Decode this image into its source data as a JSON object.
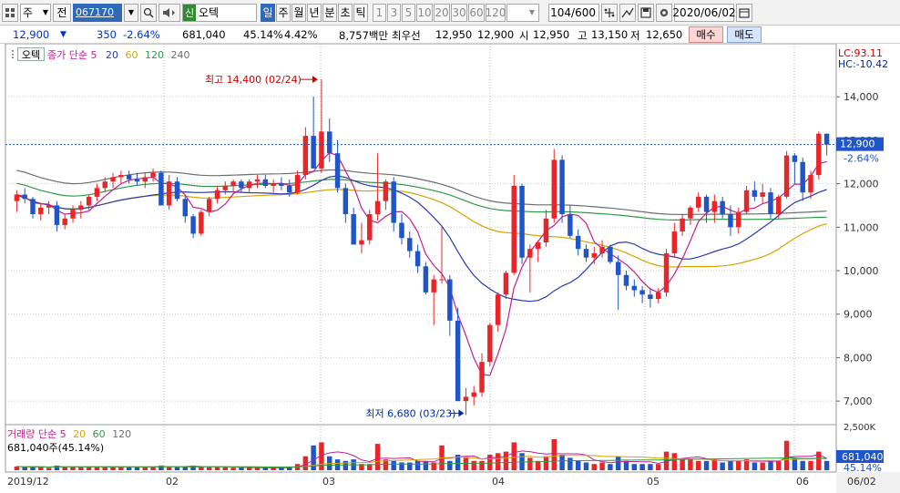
{
  "toolbar": {
    "market": "주",
    "prefix": "전",
    "code": "067170",
    "stock_name": "오텍",
    "tag": "신",
    "periods": [
      "일",
      "주",
      "월",
      "년",
      "분",
      "초",
      "틱"
    ],
    "periods_active": 0,
    "intervals": [
      "1",
      "3",
      "5",
      "10",
      "20",
      "30",
      "60",
      "120"
    ],
    "page_count": "104/600",
    "date": "2020/06/02"
  },
  "quote": {
    "price": "12,900",
    "change": "350",
    "change_pct": "-2.64%",
    "volume": "681,040",
    "volume_ratio": "45.14%",
    "turnover": "4.42%",
    "amount": "8,757백만",
    "best_label": "최우선",
    "best_ask": "12,950",
    "best_bid": "12,900",
    "open_label": "시",
    "open": "12,950",
    "high_label": "고",
    "high": "13,150",
    "low_label": "저",
    "low": "12,650",
    "buy_label": "매수",
    "sell_label": "매도"
  },
  "chart_data": {
    "type": "candlestick",
    "price_legend": {
      "tab": "오텍",
      "ma_label": "종가 단순",
      "periods": [
        "5",
        "20",
        "60",
        "120",
        "240"
      ]
    },
    "volume_legend": {
      "title": "거래량 단순",
      "periods": [
        "5",
        "20",
        "60",
        "120"
      ],
      "value": "681,040주(45.14%)"
    },
    "annotations": {
      "high": "최고 14,400 (02/24)",
      "low": "최저 6,680 (03/23)",
      "lc": "LC:93.11",
      "hc": "HC:-10.42"
    },
    "last_price": {
      "value": "12,900",
      "change": "-2.64%"
    },
    "last_volume": {
      "value": "681,040",
      "pct": "45.14%"
    },
    "price_ticks": [
      "14,000",
      "13,000",
      "12,000",
      "11,000",
      "10,000",
      "9,000",
      "8,000",
      "7,000"
    ],
    "price_tick_values": [
      14000,
      13000,
      12000,
      11000,
      10000,
      9000,
      8000,
      7000
    ],
    "volume_tick": "2,500K",
    "x_labels": [
      "2019/12",
      "02",
      "03",
      "04",
      "05",
      "06",
      "06/02"
    ],
    "ylim": [
      6500,
      14800
    ],
    "colors": {
      "up": "#e8262a",
      "down": "#1f55c8",
      "ma5": "#c02090",
      "ma20": "#2a3bb0",
      "ma60": "#d6a300",
      "ma120": "#2e9a48",
      "ma240": "#6e6e6e"
    },
    "candles": [
      [
        11600,
        11850,
        11350,
        11750
      ],
      [
        11750,
        11900,
        11550,
        11650
      ],
      [
        11650,
        11700,
        11200,
        11300
      ],
      [
        11300,
        11550,
        11150,
        11450
      ],
      [
        11450,
        11600,
        11300,
        11500
      ],
      [
        11500,
        11600,
        10900,
        11050
      ],
      [
        11050,
        11300,
        10950,
        11200
      ],
      [
        11200,
        11500,
        11100,
        11400
      ],
      [
        11400,
        11600,
        11200,
        11500
      ],
      [
        11500,
        11750,
        11400,
        11700
      ],
      [
        11700,
        12000,
        11600,
        11900
      ],
      [
        11900,
        12150,
        11800,
        12050
      ],
      [
        12050,
        12250,
        11900,
        12150
      ],
      [
        12150,
        12300,
        12000,
        12200
      ],
      [
        12200,
        12300,
        12000,
        12100
      ],
      [
        12100,
        12250,
        11950,
        12050
      ],
      [
        12050,
        12250,
        11900,
        12150
      ],
      [
        12150,
        12350,
        12050,
        12250
      ],
      [
        12250,
        12300,
        11750,
        11500
      ],
      [
        11500,
        12200,
        11400,
        12050
      ],
      [
        12050,
        12150,
        11600,
        11650
      ],
      [
        11650,
        11700,
        11100,
        11250
      ],
      [
        11250,
        11300,
        10750,
        10850
      ],
      [
        10850,
        11400,
        10800,
        11350
      ],
      [
        11350,
        11700,
        11250,
        11650
      ],
      [
        11650,
        11950,
        11550,
        11850
      ],
      [
        11850,
        12050,
        11750,
        11950
      ],
      [
        11950,
        12100,
        11800,
        12050
      ],
      [
        12050,
        12100,
        11800,
        11900
      ],
      [
        11900,
        12100,
        11800,
        12050
      ],
      [
        12050,
        12200,
        11900,
        12100
      ],
      [
        12100,
        12200,
        11900,
        11950
      ],
      [
        11950,
        12100,
        11800,
        12000
      ],
      [
        12000,
        12150,
        11850,
        11950
      ],
      [
        11950,
        12100,
        11700,
        11800
      ],
      [
        11800,
        12300,
        11750,
        12200
      ],
      [
        12200,
        13300,
        12100,
        13100
      ],
      [
        13100,
        14000,
        12600,
        12350
      ],
      [
        12350,
        14400,
        12250,
        13200
      ],
      [
        13200,
        13500,
        12500,
        12700
      ],
      [
        12700,
        13000,
        11800,
        11900
      ],
      [
        11900,
        12000,
        11100,
        11300
      ],
      [
        11300,
        11450,
        10600,
        10600
      ],
      [
        10600,
        11100,
        10400,
        10700
      ],
      [
        10700,
        11400,
        10600,
        11300
      ],
      [
        11300,
        12700,
        11150,
        11600
      ],
      [
        11600,
        12100,
        11400,
        12050
      ],
      [
        12050,
        12150,
        10900,
        11100
      ],
      [
        11100,
        11300,
        10600,
        10750
      ],
      [
        10750,
        10900,
        10300,
        10450
      ],
      [
        10450,
        10600,
        9950,
        10100
      ],
      [
        10100,
        10200,
        9450,
        9500
      ],
      [
        9500,
        9900,
        8750,
        9800
      ],
      [
        9800,
        11000,
        9700,
        9800
      ],
      [
        9800,
        9900,
        8500,
        8850
      ],
      [
        8850,
        9150,
        7000,
        7000
      ],
      [
        7000,
        7300,
        6680,
        7100
      ],
      [
        7100,
        7350,
        6900,
        7200
      ],
      [
        7200,
        8100,
        7100,
        7900
      ],
      [
        7900,
        8800,
        7800,
        8750
      ],
      [
        8750,
        9500,
        8600,
        9450
      ],
      [
        9450,
        10000,
        9350,
        9950
      ],
      [
        9950,
        12200,
        9900,
        11950
      ],
      [
        11950,
        12000,
        10150,
        10300
      ],
      [
        10300,
        10600,
        9500,
        10500
      ],
      [
        10500,
        10700,
        10200,
        10650
      ],
      [
        10650,
        11400,
        10550,
        11200
      ],
      [
        11200,
        12800,
        11100,
        12550
      ],
      [
        12550,
        12650,
        11100,
        11300
      ],
      [
        11300,
        11500,
        10750,
        10800
      ],
      [
        10800,
        10950,
        10350,
        10500
      ],
      [
        10500,
        10600,
        10200,
        10300
      ],
      [
        10300,
        10550,
        10150,
        10400
      ],
      [
        10400,
        10700,
        10300,
        10550
      ],
      [
        10550,
        10600,
        10150,
        10200
      ],
      [
        10200,
        10350,
        9100,
        9900
      ],
      [
        9900,
        10000,
        9550,
        9650
      ],
      [
        9650,
        9800,
        9400,
        9550
      ],
      [
        9550,
        9650,
        9250,
        9450
      ],
      [
        9450,
        9600,
        9150,
        9350
      ],
      [
        9350,
        9600,
        9250,
        9500
      ],
      [
        9500,
        10500,
        9400,
        10400
      ],
      [
        10400,
        11100,
        10300,
        10900
      ],
      [
        10900,
        11300,
        10800,
        11200
      ],
      [
        11200,
        11500,
        11050,
        11450
      ],
      [
        11450,
        11800,
        11350,
        11700
      ],
      [
        11700,
        11750,
        11100,
        11350
      ],
      [
        11350,
        11750,
        11100,
        11600
      ],
      [
        11600,
        11700,
        11200,
        11300
      ],
      [
        11300,
        11500,
        10800,
        11000
      ],
      [
        11000,
        11450,
        10850,
        11350
      ],
      [
        11350,
        11950,
        11300,
        11850
      ],
      [
        11850,
        12050,
        11600,
        11700
      ],
      [
        11700,
        12000,
        11550,
        11800
      ],
      [
        11800,
        11900,
        11200,
        11300
      ],
      [
        11300,
        11750,
        11200,
        11700
      ],
      [
        11700,
        12750,
        11650,
        12650
      ],
      [
        12650,
        12700,
        12000,
        12500
      ],
      [
        12500,
        12600,
        11600,
        11800
      ],
      [
        11800,
        12300,
        11650,
        12200
      ],
      [
        12200,
        13200,
        12100,
        13150
      ],
      [
        13150,
        13150,
        12650,
        12900
      ]
    ],
    "volumes": [
      0.12,
      0.1,
      0.12,
      0.1,
      0.08,
      0.15,
      0.1,
      0.1,
      0.1,
      0.12,
      0.12,
      0.12,
      0.1,
      0.1,
      0.1,
      0.1,
      0.1,
      0.12,
      0.15,
      0.12,
      0.1,
      0.12,
      0.15,
      0.12,
      0.1,
      0.1,
      0.1,
      0.08,
      0.08,
      0.08,
      0.08,
      0.08,
      0.08,
      0.08,
      0.1,
      0.2,
      0.45,
      0.8,
      0.9,
      0.45,
      0.35,
      0.3,
      0.35,
      0.2,
      0.2,
      0.85,
      0.35,
      0.3,
      0.25,
      0.25,
      0.3,
      0.3,
      0.25,
      0.8,
      0.3,
      0.5,
      0.4,
      0.3,
      0.3,
      0.5,
      0.55,
      0.6,
      0.9,
      0.55,
      0.4,
      0.3,
      0.45,
      1.0,
      0.5,
      0.4,
      0.3,
      0.25,
      0.2,
      0.25,
      0.2,
      0.45,
      0.3,
      0.2,
      0.2,
      0.2,
      0.2,
      0.6,
      0.55,
      0.35,
      0.35,
      0.3,
      0.3,
      0.35,
      0.25,
      0.3,
      0.3,
      0.35,
      0.25,
      0.25,
      0.3,
      0.3,
      0.95,
      0.4,
      0.3,
      0.3,
      0.6,
      0.3
    ]
  }
}
